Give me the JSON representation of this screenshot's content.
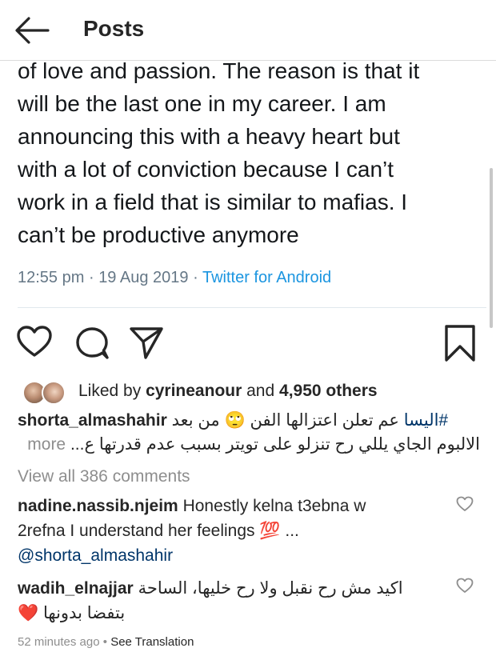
{
  "header": {
    "title": "Posts",
    "back_icon": "arrow-left-icon"
  },
  "tweet": {
    "lines": [
      "of love and passion. The reason is that it",
      "will be the last one in my career. I am",
      "announcing this with a heavy heart but",
      "with a lot of conviction because I can’t",
      "work in a field that is similar to mafias. I",
      "can’t be productive anymore"
    ],
    "time": "12:55 pm",
    "date": "19 Aug 2019",
    "separator": "·",
    "source": "Twitter for Android"
  },
  "actions": {
    "like_icon": "heart-icon",
    "comment_icon": "comment-icon",
    "share_icon": "share-icon",
    "save_icon": "bookmark-icon"
  },
  "likes": {
    "prefix": "Liked by",
    "user": "cyrineanour",
    "and": "and",
    "count": "4,950 others"
  },
  "caption": {
    "username": "shorta_almashahir",
    "hashtag": "#اليسا",
    "line1_text": "عم تعلن اعتزالها الفن",
    "emoji": "🙄",
    "line1_end": "من بعد",
    "line2_text": "الالبوم الجاي يللي رح تنزلو على تويتر بسبب عدم قدرتها ع...",
    "more": "more"
  },
  "view_all": "View all 386 comments",
  "comments": [
    {
      "username": "nadine.nassib.njeim",
      "line1": "Honestly kelna t3ebna w",
      "line2": "2refna I understand her feelings",
      "emoji": "💯",
      "ellipsis": "...",
      "mention": "@shorta_almashahir"
    },
    {
      "username": "wadih_elnajjar",
      "line1": "اكيد مش رح نقبل ولا رح خليها، الساحة",
      "line2": "بتفضا بدونها",
      "emoji": "❤️"
    }
  ],
  "footer": {
    "time": "52 minutes ago",
    "dot": "•",
    "see_translation": "See Translation"
  },
  "colors": {
    "link": "#1b95e0",
    "muted": "#8e8e8e",
    "text": "#262626",
    "heart": "#ed4956"
  }
}
